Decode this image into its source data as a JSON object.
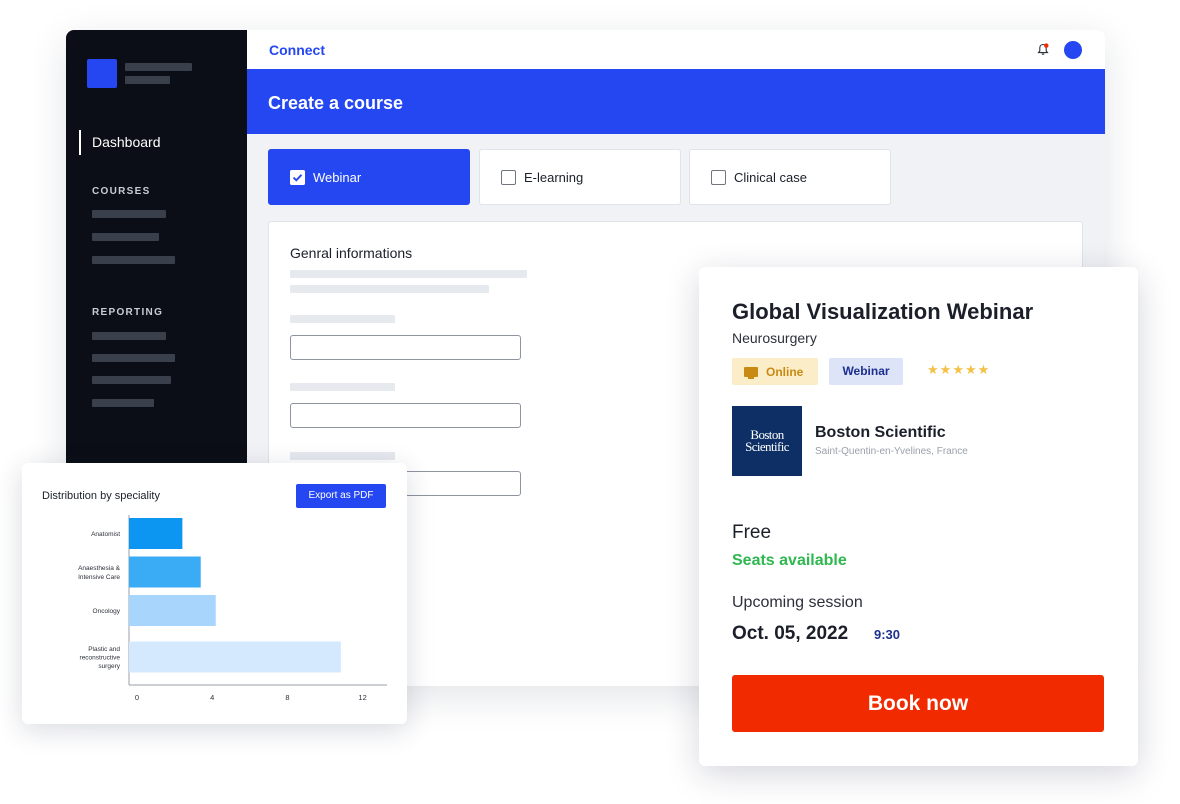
{
  "topbar": {
    "brand": "Connect",
    "bell_icon": "bell-icon",
    "avatar": "user-avatar"
  },
  "sidebar": {
    "active_item": "Dashboard",
    "sections": [
      {
        "heading": "COURSES"
      },
      {
        "heading": "REPORTING"
      }
    ]
  },
  "page": {
    "title": "Create a course"
  },
  "course_types": [
    {
      "label": "Webinar",
      "selected": true
    },
    {
      "label": "E-learning",
      "selected": false
    },
    {
      "label": "Clinical case",
      "selected": false
    }
  ],
  "form": {
    "section_title": "Genral informations"
  },
  "chart_card": {
    "title": "Distribution by speciality",
    "export_label": "Export as PDF"
  },
  "chart_data": {
    "type": "bar",
    "orientation": "horizontal",
    "title": "Distribution by speciality",
    "categories": [
      "Anatomist",
      "Anaesthesia & Intensive Care",
      "Oncology",
      "Plastic and reconstructive surgery"
    ],
    "category_lines": [
      [
        "Anatomist"
      ],
      [
        "Anaesthesia &",
        "Intensive Care"
      ],
      [
        "Oncology"
      ],
      [
        "Plastic and",
        "reconstructive",
        "surgery"
      ]
    ],
    "values": [
      3.2,
      4.3,
      5.2,
      12.7
    ],
    "colors": [
      "#0c96f2",
      "#3aabf5",
      "#a7d5fb",
      "#d4e9fd"
    ],
    "x_ticks": [
      0,
      4,
      8,
      12
    ],
    "xlim": [
      0,
      15
    ],
    "grid": false,
    "legend": "none"
  },
  "event": {
    "title": "Global Visualization Webinar",
    "specialty": "Neurosurgery",
    "tags": {
      "online": "Online",
      "webinar": "Webinar"
    },
    "rating": 5,
    "organizer": {
      "logo_text": "Boston Scientific",
      "name": "Boston Scientific",
      "location": "Saint-Quentin-en-Yvelines, France"
    },
    "price": "Free",
    "availability": "Seats available",
    "session_label": "Upcoming session",
    "session_date": "Oct. 05, 2022",
    "session_time": "9:30",
    "cta": "Book now"
  },
  "colors": {
    "primary": "#2447f2",
    "sidebar": "#0b0e16",
    "cta": "#f22a00",
    "success": "#2fb84f",
    "online_tag": "#fbedc8",
    "webinar_tag": "#dde4f7"
  }
}
